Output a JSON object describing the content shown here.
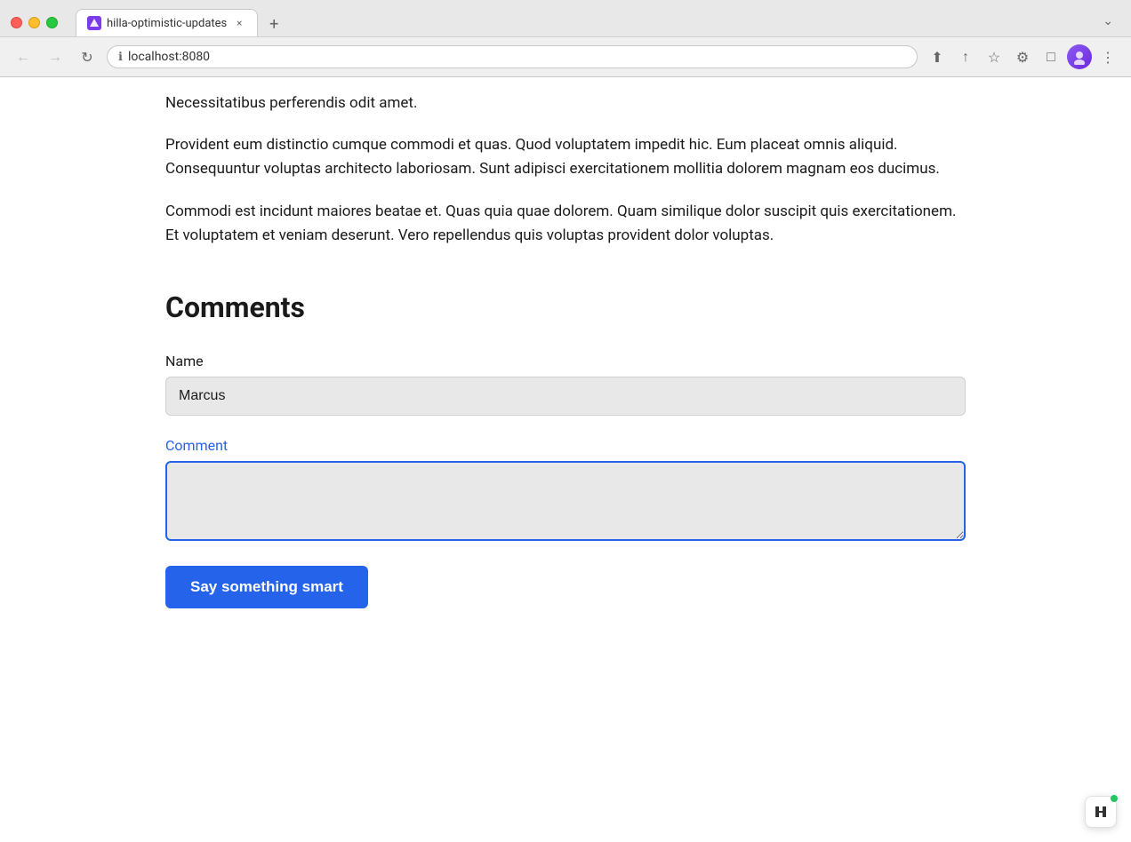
{
  "browser": {
    "tab_title": "hilla-optimistic-updates",
    "tab_favicon": "H",
    "close_label": "×",
    "new_tab_label": "+",
    "dropdown_label": "⌄",
    "back_label": "←",
    "forward_label": "→",
    "refresh_label": "↻",
    "url": "localhost:8080",
    "screenshot_btn": "⬆",
    "share_btn": "↑",
    "bookmark_btn": "☆",
    "extensions_btn": "⚙",
    "sidebar_btn": "□",
    "more_btn": "⋮"
  },
  "content": {
    "paragraph1": "Necessitatibus perferendis odit amet.",
    "paragraph2": "Provident eum distinctio cumque commodi et quas. Quod voluptatem impedit hic. Eum placeat omnis aliquid. Consequuntur voluptas architecto laboriosam. Sunt adipisci exercitationem mollitia dolorem magnam eos ducimus.",
    "paragraph3": "Commodi est incidunt maiores beatae et. Quas quia quae dolorem. Quam similique dolor suscipit quis exercitationem. Et voluptatem et veniam deserunt. Vero repellendus quis voluptas provident dolor voluptas.",
    "comments_heading": "Comments",
    "name_label": "Name",
    "name_value": "Marcus",
    "name_placeholder": "Name",
    "comment_label": "Comment",
    "comment_value": "",
    "comment_placeholder": "",
    "submit_label": "Say something smart"
  }
}
